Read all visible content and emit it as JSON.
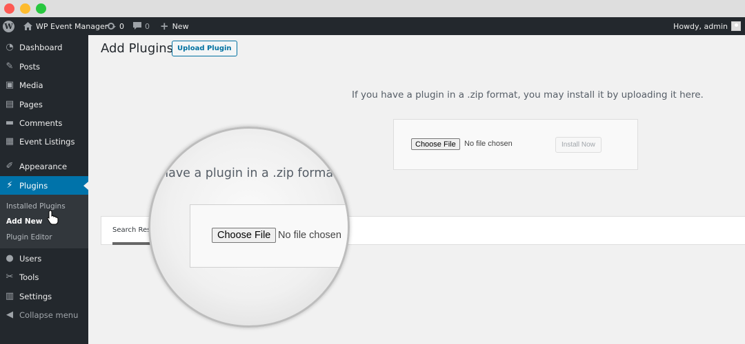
{
  "window": {
    "controls": [
      "close",
      "minimize",
      "maximize"
    ]
  },
  "adminbar": {
    "site_name": "WP Event Manager",
    "updates_count": "0",
    "comments_count": "0",
    "new_label": "New",
    "greeting": "Howdy, admin",
    "icons": {
      "logo": "wordpress-logo-icon",
      "site": "home-icon",
      "updates": "refresh-icon",
      "comments": "comment-bubble-icon",
      "new": "plus-icon",
      "avatar": "avatar-icon"
    }
  },
  "sidebar": {
    "items": [
      {
        "label": "Dashboard",
        "icon": "◔"
      },
      {
        "label": "Posts",
        "icon": "✎"
      },
      {
        "label": "Media",
        "icon": "▣"
      },
      {
        "label": "Pages",
        "icon": "▤"
      },
      {
        "label": "Comments",
        "icon": "▬"
      },
      {
        "label": "Event Listings",
        "icon": "▦"
      },
      {
        "label": "Appearance",
        "icon": "✐"
      },
      {
        "label": "Plugins",
        "icon": "⚡"
      },
      {
        "label": "Users",
        "icon": "●"
      },
      {
        "label": "Tools",
        "icon": "✂"
      },
      {
        "label": "Settings",
        "icon": "▥"
      }
    ],
    "active": "Plugins",
    "submenu": [
      {
        "label": "Installed Plugins"
      },
      {
        "label": "Add New"
      },
      {
        "label": "Plugin Editor"
      }
    ],
    "submenu_current": "Add New",
    "collapse_label": "Collapse menu",
    "collapse_icon": "◀"
  },
  "main": {
    "title": "Add Plugins",
    "upload_button": "Upload Plugin",
    "help_text": "If you have a plugin in a .zip format, you may install it by uploading it here.",
    "file_button": "Choose File",
    "file_status": "No file chosen",
    "install_button": "Install Now",
    "filter_tab": "Search Results"
  },
  "magnifier": {
    "text": "have a plugin in a .zip format,",
    "file_button": "Choose File",
    "file_status": "No file chosen"
  }
}
